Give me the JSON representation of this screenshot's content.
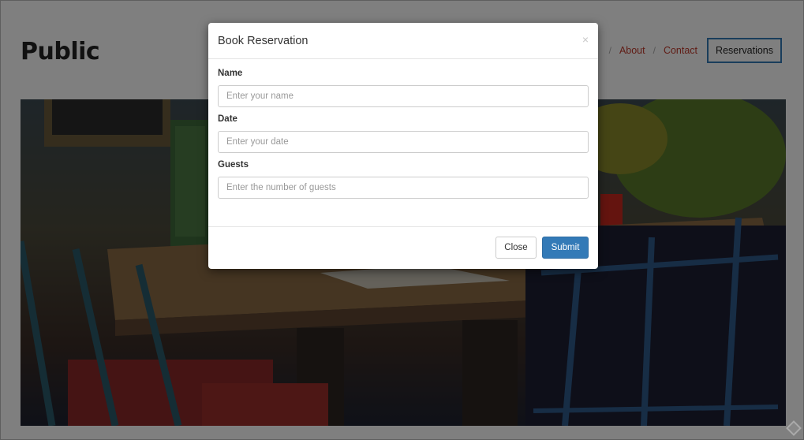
{
  "site": {
    "brand": "Public",
    "nav": {
      "separator": "/",
      "items": [
        "About",
        "Contact"
      ],
      "reservations_button": "Reservations"
    }
  },
  "modal": {
    "title": "Book Reservation",
    "close_icon": "×",
    "fields": [
      {
        "label": "Name",
        "placeholder": "Enter your name"
      },
      {
        "label": "Date",
        "placeholder": "Enter your date"
      },
      {
        "label": "Guests",
        "placeholder": "Enter the number of guests"
      }
    ],
    "close_button": "Close",
    "submit_button": "Submit"
  },
  "colors": {
    "accent": "#337ab7",
    "nav_link": "#c0392b"
  },
  "icons": {
    "corner": "diamond-icon"
  }
}
